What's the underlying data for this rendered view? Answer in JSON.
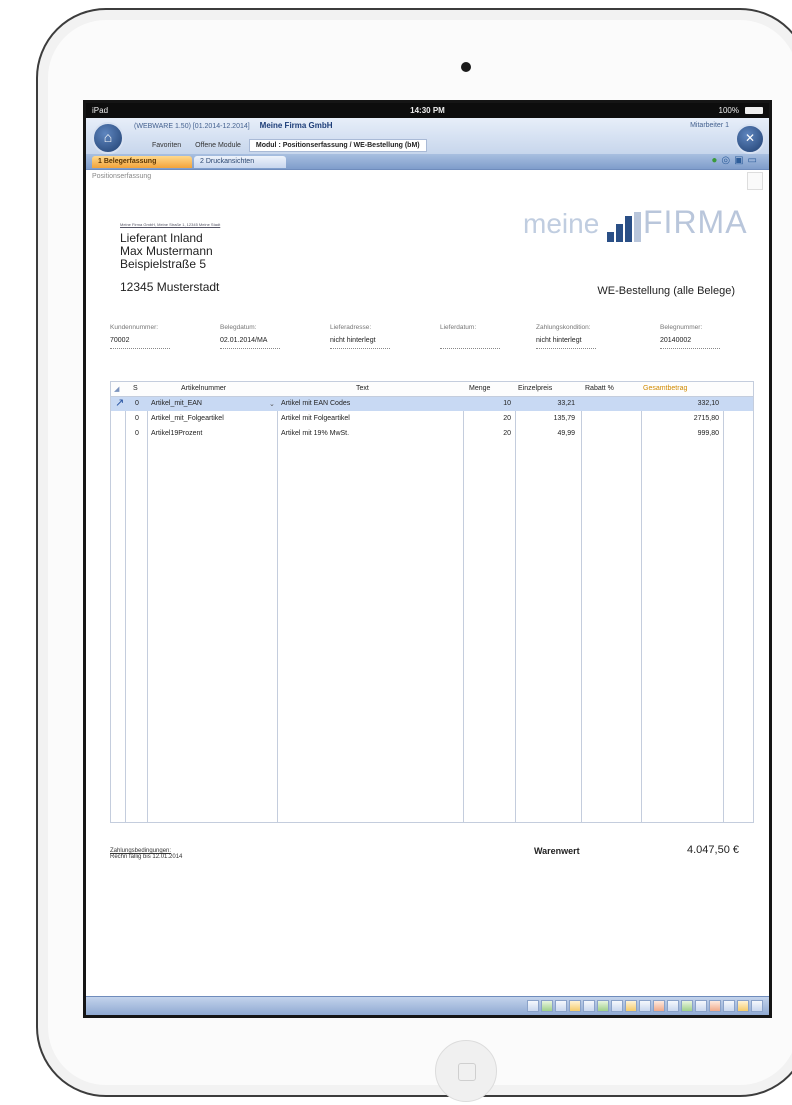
{
  "statusbar": {
    "left": "iPad",
    "time": "14:30 PM",
    "battery": "100%"
  },
  "titlebar": {
    "titleline": "(WEBWARE 1.50)   [01.2014-12.2014]",
    "company": "Meine Firma GmbH",
    "user": "Mitarbeiter 1",
    "menu": [
      "Favoriten",
      "Offene Module",
      "Modul : Positionserfassung / WE-Bestellung (bM)"
    ]
  },
  "tabs": [
    "1 Belegerfassung",
    "2 Druckansichten"
  ],
  "breadcrumb": "Positionserfassung",
  "sender_line": "Meine Firma GmbH, Meine Straße 1, 12345 Meine Stadt",
  "address": {
    "line1": "Lieferant Inland",
    "line2": "Max Mustermann",
    "line3": "Beispielstraße 5",
    "city": "12345 Musterstadt"
  },
  "logo": {
    "prefix": "meine",
    "suffix": "FIRMA"
  },
  "document_title": "WE-Bestellung (alle Belege)",
  "header_fields": [
    {
      "label": "Kundennummer:",
      "value": "70002"
    },
    {
      "label": "Belegdatum:",
      "value": "02.01.2014/MA"
    },
    {
      "label": "Lieferadresse:",
      "value": "nicht hinterlegt"
    },
    {
      "label": "Lieferdatum:",
      "value": ""
    },
    {
      "label": "Zahlungskondition:",
      "value": "nicht hinterlegt"
    },
    {
      "label": "Belegnummer:",
      "value": "20140002"
    }
  ],
  "table": {
    "headers": {
      "s": "S",
      "artikel": "Artikelnummer",
      "text": "Text",
      "menge": "Menge",
      "preis": "Einzelpreis",
      "rabatt": "Rabatt %",
      "gesamt": "Gesamtbetrag"
    },
    "rows": [
      {
        "s": "0",
        "artikel": "Artikel_mit_EAN",
        "text": "Artikel mit EAN Codes",
        "menge": "10",
        "preis": "33,21",
        "gesamt": "332,10"
      },
      {
        "s": "0",
        "artikel": "Artikel_mit_Folgeartikel",
        "text": "Artikel mit Folgeartikel",
        "menge": "20",
        "preis": "135,79",
        "gesamt": "2715,80"
      },
      {
        "s": "0",
        "artikel": "Artikel19Prozent",
        "text": "Artikel mit 19% MwSt.",
        "menge": "20",
        "preis": "49,99",
        "gesamt": "999,80"
      }
    ]
  },
  "footer": {
    "conditions_title": "Zahlungsbedingungen:",
    "conditions_text": "Rechn fällig bis 12.01.2014",
    "waren_label": "Warenwert",
    "total": "4.047,50 €"
  }
}
